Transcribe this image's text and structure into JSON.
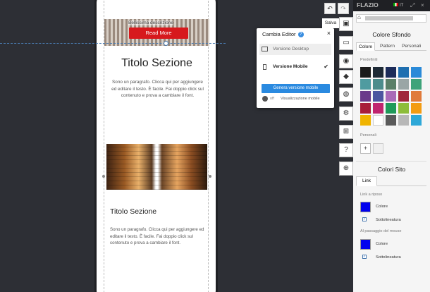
{
  "phone_preview": {
    "hero_caption": "Bellissima descrizione",
    "read_more": "Read More",
    "section_title": "Titolo Sezione",
    "section_text": "Sono un paragrafo. Clicca qui per aggiungere ed editare il testo. È facile. Fai doppio click sul contenuto e prova a cambiare il font.",
    "subsection_title": "Titolo Sezione",
    "subsection_text": "Sono un paragrafo. Clicca qui per aggiungere ed editare il testo. È facile. Fai doppio click sul contenuto e prova a cambiare il font."
  },
  "dialog": {
    "title": "Cambia Editor",
    "help": "?",
    "close": "×",
    "options": [
      {
        "label": "Versione Desktop",
        "selected": false
      },
      {
        "label": "Versione Mobile",
        "selected": true
      }
    ],
    "checkmark": "✔",
    "generate_button": "Genera versione mobile",
    "toggle_state": "off",
    "toggle_label": "Visualizzazione mobile"
  },
  "toolbar": {
    "undo": "↶",
    "redo": "↷",
    "save": "Salva",
    "tools": [
      {
        "name": "save-disk-icon",
        "glyph": "▣"
      },
      {
        "name": "desktop-icon",
        "glyph": "▭"
      },
      {
        "name": "eye-icon",
        "glyph": "◉"
      },
      {
        "name": "paint-bucket-icon",
        "glyph": "◆"
      },
      {
        "name": "palette-icon",
        "glyph": "◍"
      },
      {
        "name": "gear-icon",
        "glyph": "⚙"
      },
      {
        "name": "add-page-icon",
        "glyph": "⊞"
      },
      {
        "name": "help-icon",
        "glyph": "?"
      },
      {
        "name": "crosshair-icon",
        "glyph": "⊕"
      }
    ]
  },
  "topbar": {
    "logo": "FLAZIO",
    "language": "IT",
    "expand_icon": "⤢",
    "close_icon": "×"
  },
  "panel": {
    "home_icon": "⌂",
    "title_bg": "Colore Sfondo",
    "tabs": [
      "Colore",
      "Pattern",
      "Personali"
    ],
    "predefined_label": "Predefiniti",
    "swatch_colors": [
      "#1b1b1b",
      "#1e2a36",
      "#1c2c5a",
      "#1f6fb0",
      "#2a8ad8",
      "#4f9ba0",
      "#4c8c8c",
      "#5a7f68",
      "#9aa6a6",
      "#3ea37a",
      "#6a3a8a",
      "#4c56a0",
      "#a96ab8",
      "#a0263a",
      "#e07a3a",
      "#a81d3a",
      "#c0246e",
      "#1f9a5a",
      "#8dbd3a",
      "#f39c12",
      "#f0b400",
      "#ffffff",
      "#5a5a5a",
      "#b8b8b8",
      "#2ea8d8"
    ],
    "personal_label": "Personali",
    "add": "+",
    "title_site": "Colori Sito",
    "link_tab": "Link",
    "rest_label": "Link a riposo",
    "color_label": "Colore",
    "underline_label": "Sottolineatura",
    "hover_label": "Al passaggio del mouse",
    "color_label_2": "Colore",
    "underline_label_2": "Sottolineatura",
    "check": "✓",
    "link_color": "#0000ee"
  }
}
